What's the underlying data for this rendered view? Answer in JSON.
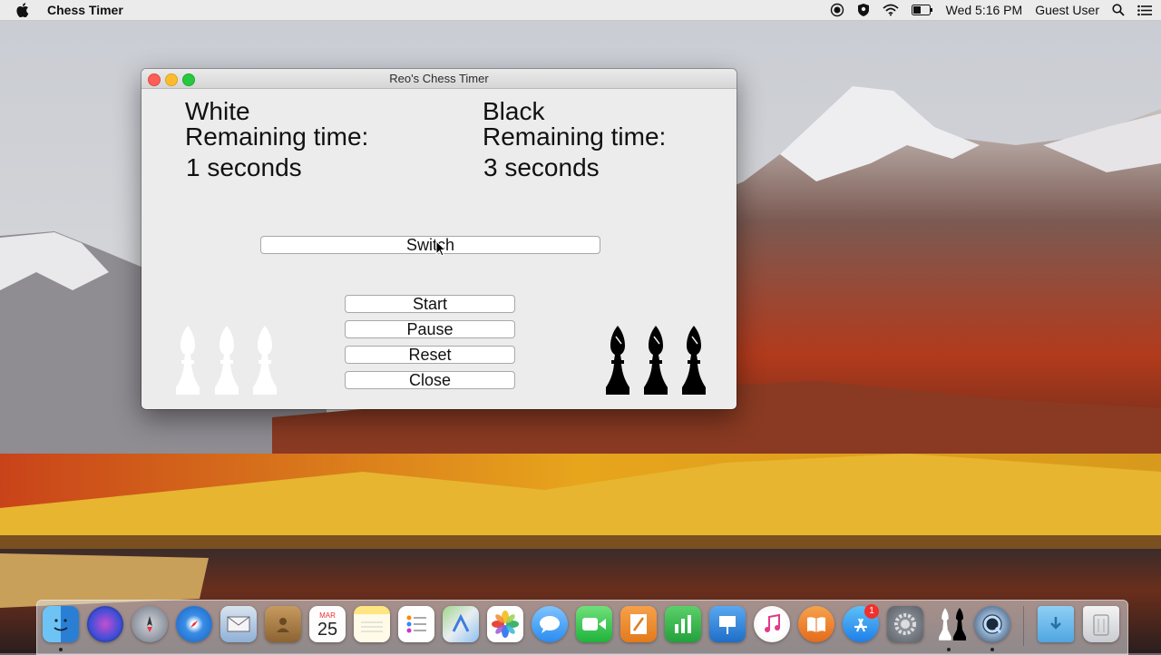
{
  "menubar": {
    "app_name": "Chess Timer",
    "clock": "Wed 5:16 PM",
    "user": "Guest User",
    "status_icons": [
      "record-icon",
      "shield-icon",
      "wifi-icon",
      "battery-icon",
      "search-icon",
      "list-icon"
    ]
  },
  "window": {
    "title": "Reo's Chess Timer",
    "white": {
      "player": "White",
      "label": "Remaining time:",
      "time": "1 seconds"
    },
    "black": {
      "player": "Black",
      "label": "Remaining time:",
      "time": "3 seconds"
    },
    "buttons": {
      "switch": "Switch",
      "start": "Start",
      "pause": "Pause",
      "reset": "Reset",
      "close": "Close"
    },
    "pieces": {
      "white": [
        "bishop",
        "bishop",
        "bishop"
      ],
      "black": [
        "bishop",
        "bishop",
        "bishop"
      ]
    }
  },
  "dock": {
    "calendar_month": "MAR",
    "calendar_day": "25",
    "app_store_badge": "1",
    "icons": [
      "finder",
      "siri",
      "launchpad",
      "safari",
      "mail",
      "contacts",
      "calendar",
      "notes",
      "reminders",
      "maps",
      "photos",
      "messages",
      "facetime",
      "pages",
      "numbers",
      "keynote",
      "itunes",
      "ibooks",
      "app-store",
      "system-preferences",
      "chess-timer",
      "quicktime",
      "downloads",
      "trash"
    ]
  },
  "colors": {
    "traffic_close": "#fc5f57",
    "traffic_min": "#fdbc2e",
    "traffic_max": "#27c840",
    "window_bg": "#ececec"
  }
}
